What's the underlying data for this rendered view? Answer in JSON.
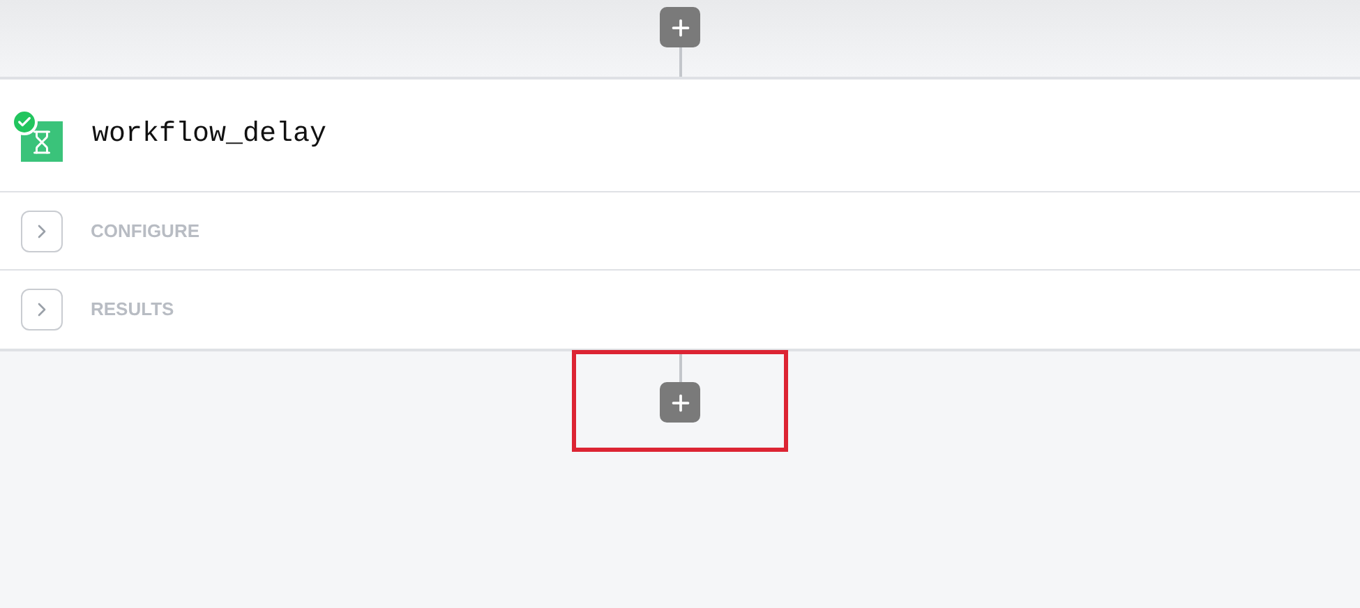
{
  "step": {
    "name": "workflow_delay",
    "succeeded": true
  },
  "sections": [
    {
      "label": "CONFIGURE",
      "expanded": false
    },
    {
      "label": "RESULTS",
      "expanded": false
    }
  ],
  "add_step_highlighted": true
}
